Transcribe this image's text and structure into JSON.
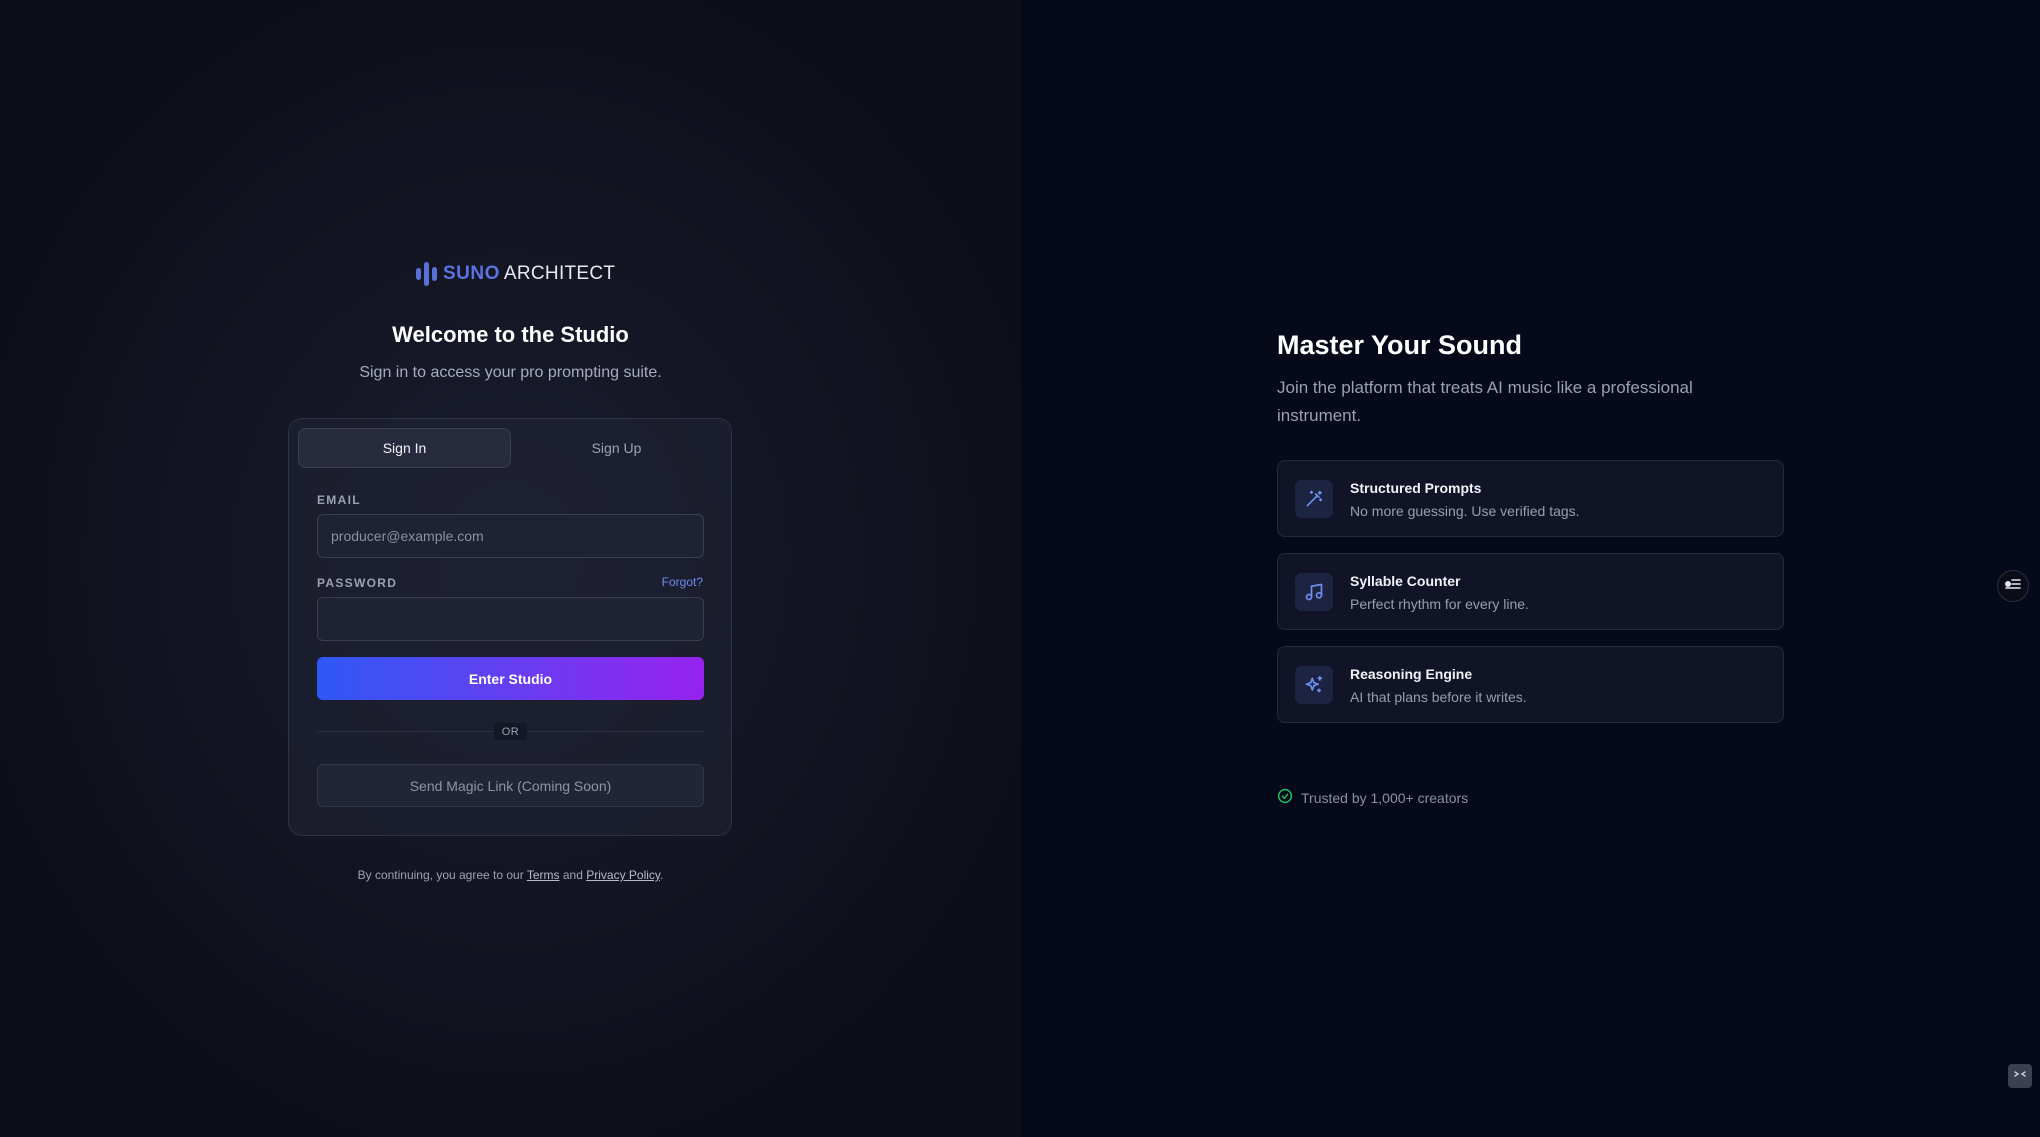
{
  "colors": {
    "accent": "#5b72e0",
    "button_gradient_start": "#2f58f6",
    "button_gradient_end": "#9722ef",
    "link": "#6d8cf2",
    "success": "#22c55e"
  },
  "logo": {
    "icon": "audio-bars-icon",
    "brand": "SUNO",
    "rest": "ARCHITECT"
  },
  "auth": {
    "title": "Welcome to the Studio",
    "subtitle": "Sign in to access your pro prompting suite.",
    "tabs": [
      {
        "label": "Sign In",
        "active": true
      },
      {
        "label": "Sign Up",
        "active": false
      }
    ],
    "email_label": "EMAIL",
    "email_placeholder": "producer@example.com",
    "email_value": "",
    "password_label": "PASSWORD",
    "password_value": "",
    "forgot_label": "Forgot?",
    "submit_label": "Enter Studio",
    "divider_label": "OR",
    "magic_link_label": "Send Magic Link (Coming Soon)"
  },
  "legal": {
    "prefix": "By continuing, you agree to our",
    "terms": "Terms",
    "and": "and",
    "privacy": "Privacy Policy",
    "suffix": "."
  },
  "promo": {
    "title": "Master Your Sound",
    "subtitle": "Join the platform that treats AI music like a professional instrument.",
    "features": [
      {
        "icon": "magic-wand-icon",
        "title": "Structured Prompts",
        "description": "No more guessing. Use verified tags."
      },
      {
        "icon": "music-note-icon",
        "title": "Syllable Counter",
        "description": "Perfect rhythm for every line."
      },
      {
        "icon": "sparkles-icon",
        "title": "Reasoning Engine",
        "description": "AI that plans before it writes."
      }
    ],
    "trusted_icon": "check-circle-icon",
    "trusted_text": "Trusted by 1,000+ creators"
  },
  "floating": {
    "side_button_icon": "toggle-list-icon",
    "corner_button_icon": "expand-icon"
  }
}
